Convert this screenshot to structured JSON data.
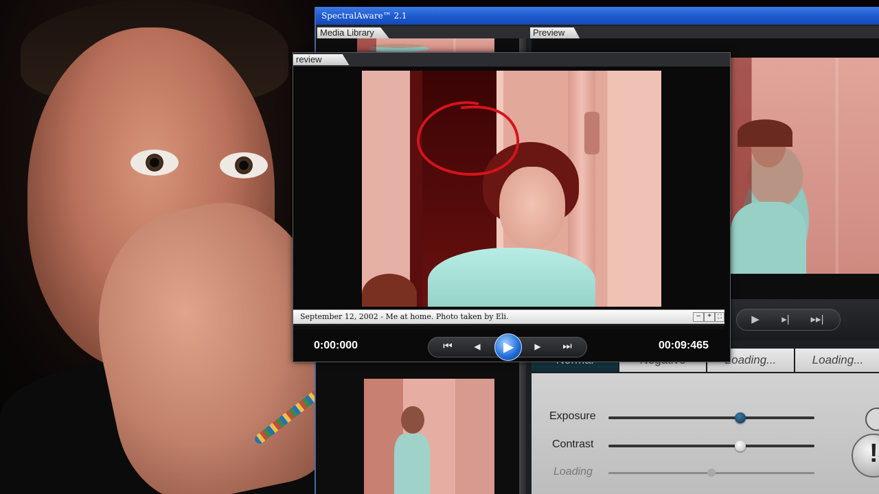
{
  "app": {
    "title": "SpectralAware™ 2.1",
    "tabs": {
      "media_library": "Media Library",
      "preview": "Preview"
    }
  },
  "preview_window": {
    "tab_label": "review",
    "caption": "September 12, 2002 - Me at home. Photo taken by Eli.",
    "time_current": "0:00:000",
    "time_total": "00:09:465",
    "transport": {
      "skip_back": "⏮",
      "step_back": "◀",
      "play": "▶",
      "step_forward": "▶",
      "skip_forward": "⏭"
    }
  },
  "modes": {
    "items": [
      "Normal",
      "Negative",
      "Loading...",
      "Loading..."
    ],
    "selected": "Normal"
  },
  "adjustments": {
    "exposure": {
      "label": "Exposure",
      "value": 0.64
    },
    "contrast": {
      "label": "Contrast",
      "value": 0.64
    },
    "loading": {
      "label": "Loading",
      "value": 0.5
    }
  },
  "colors": {
    "titlebar": "#1f5cd0",
    "annotation": "#d4141c",
    "accent_knob": "#1a4a6e"
  }
}
